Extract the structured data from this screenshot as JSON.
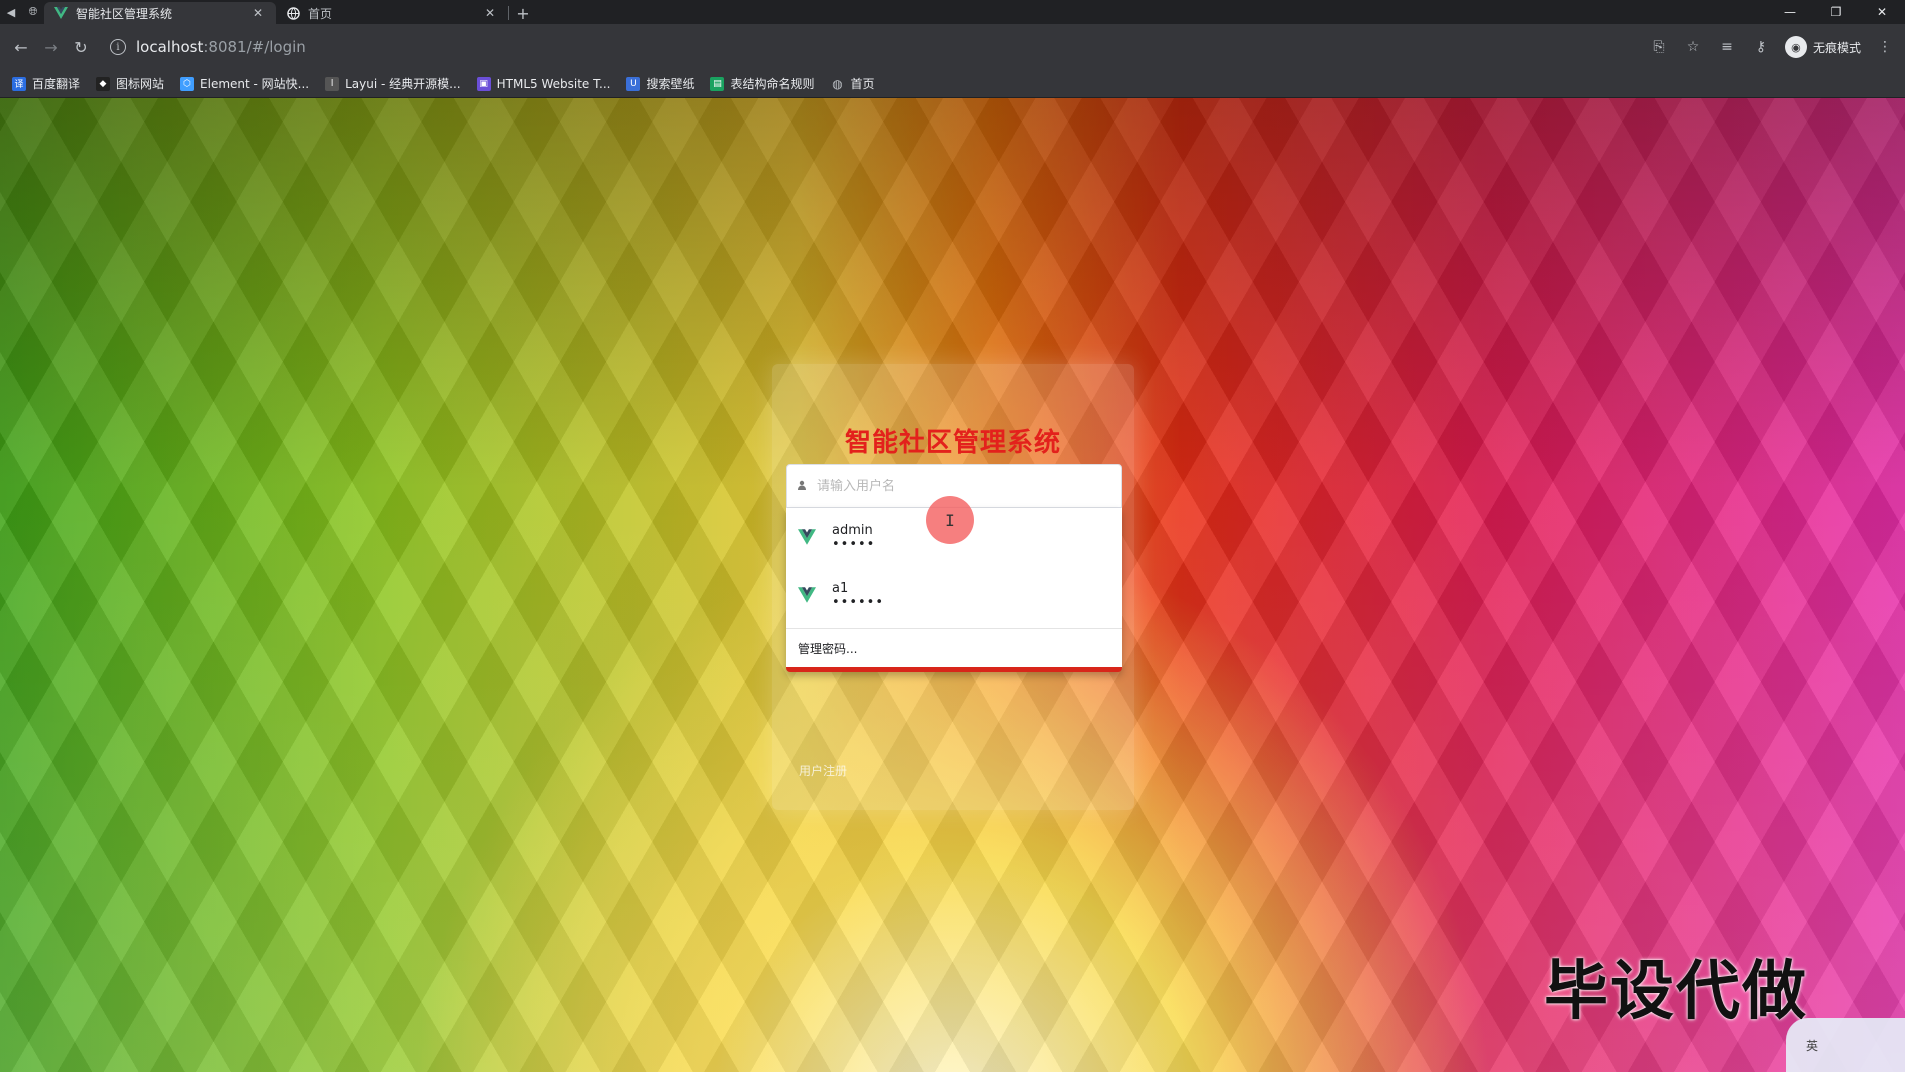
{
  "browser": {
    "tabs": [
      {
        "title": "智能社区管理系统",
        "active": true
      },
      {
        "title": "首页",
        "active": false
      }
    ],
    "url_host": "localhost",
    "url_rest": ":8081/#/login",
    "incognito_label": "无痕模式",
    "bookmarks": [
      {
        "label": "百度翻译",
        "color": "#2b6de0"
      },
      {
        "label": "图标网站",
        "color": "#222222"
      },
      {
        "label": "Element - 网站快...",
        "color": "#409eff"
      },
      {
        "label": "Layui - 经典开源模...",
        "color": "#555555"
      },
      {
        "label": "HTML5 Website T...",
        "color": "#6b4fd8"
      },
      {
        "label": "搜索壁纸",
        "color": "#3a6fd8"
      },
      {
        "label": "表结构命名规则",
        "color": "#1aa260"
      },
      {
        "label": "首页",
        "color": "#bdc1c6"
      }
    ]
  },
  "login": {
    "title": "智能社区管理系统",
    "username_placeholder": "请输入用户名",
    "register_link": "用户注册"
  },
  "autofill": {
    "items": [
      {
        "username": "admin",
        "password_mask": "•••••"
      },
      {
        "username": "a1",
        "password_mask": "••••••"
      }
    ],
    "manage_label": "管理密码..."
  },
  "overlay": {
    "watermark": "毕设代做",
    "ime_label": "英"
  },
  "colors": {
    "title_red": "#e3211c",
    "vue_green": "#41b883",
    "vue_dark": "#35495e"
  }
}
